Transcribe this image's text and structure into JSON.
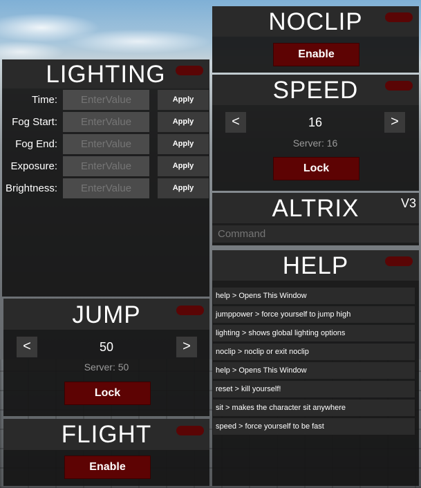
{
  "lighting": {
    "title": "LIGHTING",
    "rows": [
      {
        "label": "Time:",
        "placeholder": "EnterValue",
        "button": "Apply"
      },
      {
        "label": "Fog Start:",
        "placeholder": "EnterValue",
        "button": "Apply"
      },
      {
        "label": "Fog End:",
        "placeholder": "EnterValue",
        "button": "Apply"
      },
      {
        "label": "Exposure:",
        "placeholder": "EnterValue",
        "button": "Apply"
      },
      {
        "label": "Brightness:",
        "placeholder": "EnterValue",
        "button": "Apply"
      }
    ]
  },
  "jump": {
    "title": "JUMP",
    "decrement": "<",
    "increment": ">",
    "value": "50",
    "server": "Server: 50",
    "button": "Lock"
  },
  "flight": {
    "title": "FLIGHT",
    "button": "Enable"
  },
  "noclip": {
    "title": "NOCLIP",
    "button": "Enable"
  },
  "speed": {
    "title": "SPEED",
    "decrement": "<",
    "increment": ">",
    "value": "16",
    "server": "Server: 16",
    "button": "Lock"
  },
  "altrix": {
    "title": "ALTRIX",
    "version": "V3",
    "command_placeholder": "Command"
  },
  "help": {
    "title": "HELP",
    "items": [
      "help  >  Opens This Window",
      "jumppower  >  force yourself to jump high",
      "lighting  >  shows global lighting options",
      "noclip  >  noclip or exit noclip",
      "help  >  Opens This Window",
      "reset  >  kill yourself!",
      "sit  >  makes the character sit anywhere",
      "speed  >  force yourself to be fast"
    ]
  },
  "colors": {
    "panel": "#161616",
    "titlebar": "#2a2a2a",
    "accent_red": "#5d0303",
    "field": "#4b4b4b"
  }
}
